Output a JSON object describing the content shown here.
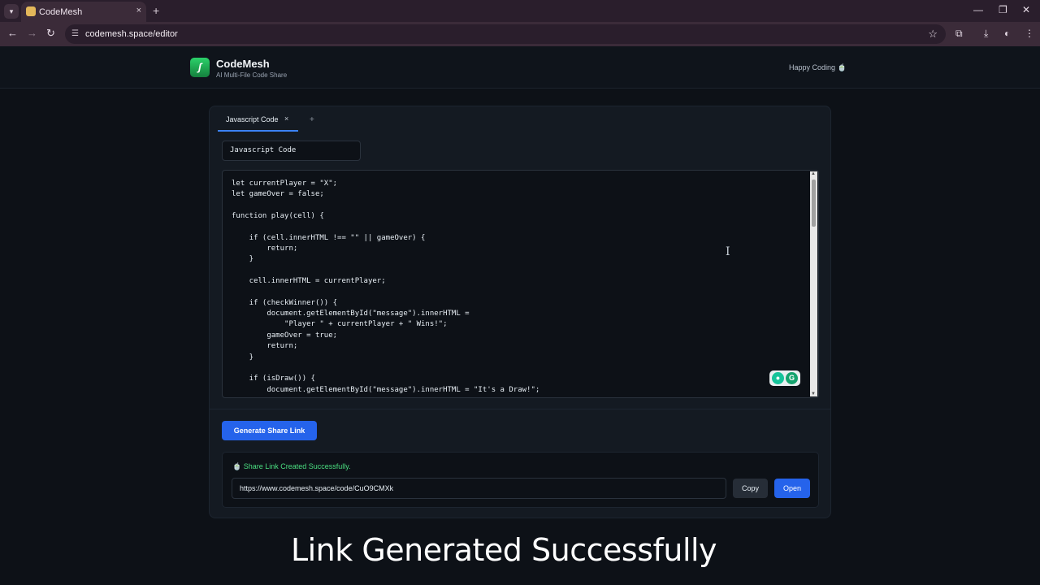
{
  "browser": {
    "tab_title": "CodeMesh",
    "tab_close": "×",
    "new_tab": "+",
    "url": "codemesh.space/editor",
    "icons": [
      "tab-menu-icon",
      "back-icon",
      "forward-icon",
      "reload-icon",
      "site-info-icon",
      "bookmark-star-icon",
      "extensions-icon",
      "download-icon",
      "profile-icon",
      "menu-icon",
      "minimize-icon",
      "maximize-icon",
      "close-icon"
    ]
  },
  "header": {
    "logo_glyph": "ʃ",
    "brand": "CodeMesh",
    "tagline": "AI Multi-File Code Share",
    "greeting": "Happy Coding 🍵"
  },
  "editor": {
    "tab_label": "Javascript Code",
    "tab_close": "×",
    "add_tab": "+",
    "file_name": "Javascript Code",
    "code": "let currentPlayer = \"X\";\nlet gameOver = false;\n\nfunction play(cell) {\n\n    if (cell.innerHTML !== \"\" || gameOver) {\n        return;\n    }\n\n    cell.innerHTML = currentPlayer;\n\n    if (checkWinner()) {\n        document.getElementById(\"message\").innerHTML =\n            \"Player \" + currentPlayer + \" Wins!\";\n        gameOver = true;\n        return;\n    }\n\n    if (isDraw()) {\n        document.getElementById(\"message\").innerHTML = \"It's a Draw!\";"
  },
  "actions": {
    "generate_label": "Generate Share Link",
    "success_message": "🍵 Share Link Created Successfully.",
    "share_url": "https://www.codemesh.space/code/CuO9CMXk",
    "copy_label": "Copy",
    "open_label": "Open"
  },
  "caption": "Link Generated Successfully",
  "colors": {
    "accent": "#2563eb",
    "success": "#4ade80",
    "background": "#0d1117"
  }
}
